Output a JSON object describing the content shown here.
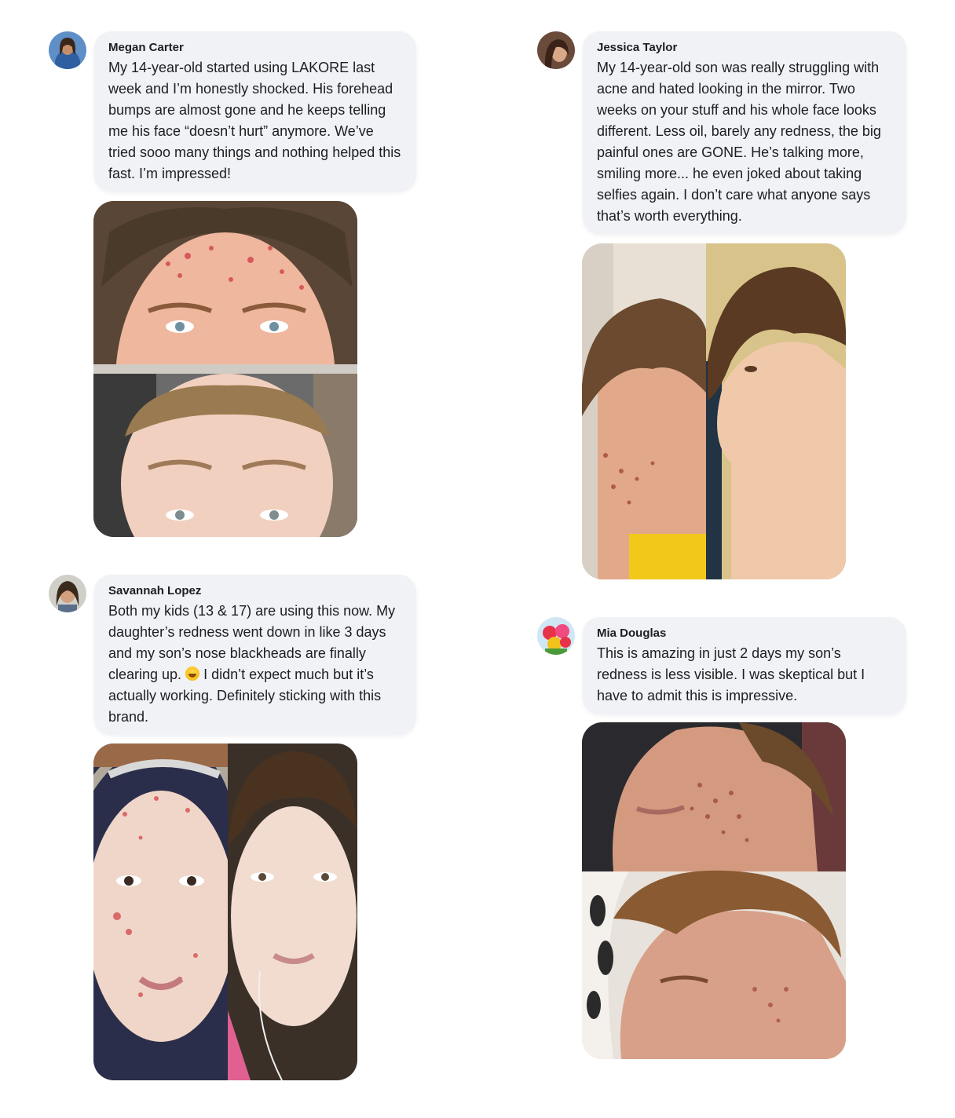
{
  "reviews": [
    {
      "name": "Megan Carter",
      "text": "My 14-year-old started using LAKORE last week and I’m honestly shocked. His forehead bumps are almost gone and he keeps telling me his face “doesn’t hurt” anymore. We’ve tried sooo many things and nothing helped this fast. I’m impressed!"
    },
    {
      "name": "Jessica Taylor",
      "text": "My 14-year-old son was really struggling with acne and hated looking in the mirror. Two weeks on your stuff and his whole face looks different. Less oil, barely any redness, the big painful ones are GONE. He’s talking more, smiling more... he even joked about taking selfies again. I don’t care what anyone says that’s worth everything."
    },
    {
      "name": "Savannah Lopez",
      "text_before_emoji": "Both my kids (13 & 17) are using this now. My daughter’s redness went down in like 3 days and my son’s nose blackheads are finally clearing up.",
      "text_after_emoji": "I didn’t expect much but it’s actually working. Definitely sticking with this brand."
    },
    {
      "name": "Mia Douglas",
      "text": "This is amazing in just 2 days my son’s redness is less visible. I was skeptical but I have to admit this is impressive."
    }
  ],
  "icons": {
    "emoji": "laughing-emoji-icon"
  }
}
